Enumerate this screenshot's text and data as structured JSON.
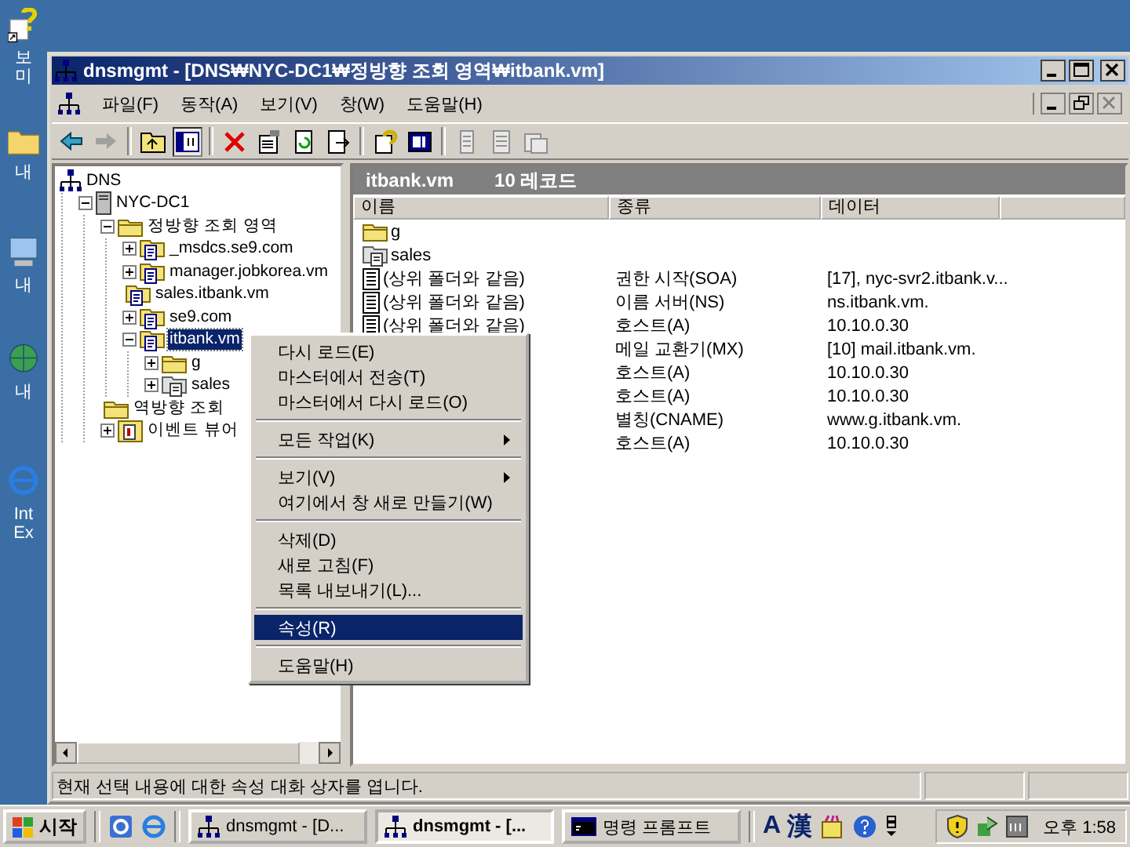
{
  "desktop_icons": [
    {
      "label": "보\n미",
      "kind": "help"
    },
    {
      "label": "내",
      "kind": "folder"
    },
    {
      "label": "내",
      "kind": "computer"
    },
    {
      "label": "내",
      "kind": "network"
    },
    {
      "label": "Int\nEx",
      "kind": "browser"
    }
  ],
  "window": {
    "title": "dnsmgmt - [DNS₩NYC-DC1₩정방향 조회 영역₩itbank.vm]"
  },
  "menu_bar": [
    "파일(F)",
    "동작(A)",
    "보기(V)",
    "창(W)",
    "도움말(H)"
  ],
  "tree": [
    {
      "label": "DNS",
      "kind": "dns",
      "selected": false,
      "children": [
        {
          "label": "NYC-DC1",
          "kind": "server",
          "expanded": true,
          "selected": false,
          "children": [
            {
              "label": "정방향 조회 영역",
              "kind": "folder",
              "expanded": true,
              "selected": false,
              "children": [
                {
                  "label": "_msdcs.se9.com",
                  "kind": "zone",
                  "expanded": false,
                  "selected": false
                },
                {
                  "label": "manager.jobkorea.vm",
                  "kind": "zone",
                  "expanded": false,
                  "selected": false
                },
                {
                  "label": "sales.itbank.vm",
                  "kind": "zone",
                  "selected": false
                },
                {
                  "label": "se9.com",
                  "kind": "zone",
                  "expanded": false,
                  "selected": false
                },
                {
                  "label": "itbank.vm",
                  "kind": "zone",
                  "expanded": true,
                  "selected": true,
                  "children": [
                    {
                      "label": "g",
                      "kind": "folder",
                      "expanded": false,
                      "selected": false
                    },
                    {
                      "label": "sales",
                      "kind": "delegation",
                      "expanded": false,
                      "selected": false
                    }
                  ]
                }
              ]
            },
            {
              "label": "역방향 조회",
              "kind": "folder",
              "selected": false
            },
            {
              "label": "이벤트 뷰어",
              "kind": "events",
              "expanded": false,
              "selected": false
            }
          ]
        }
      ]
    }
  ],
  "result_header": {
    "name": "itbank.vm",
    "count": "10 레코드"
  },
  "table": {
    "columns": [
      "이름",
      "종류",
      "데이터"
    ],
    "rows": [
      {
        "kind": "folder",
        "name": "g"
      },
      {
        "kind": "delegation",
        "name": "sales"
      },
      {
        "kind": "record",
        "name": "(상위 폴더와 같음)",
        "type": "권한 시작(SOA)",
        "data": "[17], nyc-svr2.itbank.v..."
      },
      {
        "kind": "record",
        "name": "(상위 폴더와 같음)",
        "type": "이름 서버(NS)",
        "data": "ns.itbank.vm."
      },
      {
        "kind": "record",
        "name": "(상위 폴더와 같음)",
        "type": "호스트(A)",
        "data": "10.10.0.30"
      },
      {
        "type": "메일 교환기(MX)",
        "data": "[10]  mail.itbank.vm."
      },
      {
        "type": "호스트(A)",
        "data": "10.10.0.30"
      },
      {
        "type": "호스트(A)",
        "data": "10.10.0.30"
      },
      {
        "type": "별칭(CNAME)",
        "data": "www.g.itbank.vm."
      },
      {
        "type": "호스트(A)",
        "data": "10.10.0.30"
      }
    ]
  },
  "context_menu": [
    {
      "kind": "item",
      "label": "다시 로드(E)",
      "selected": false
    },
    {
      "kind": "item",
      "label": "마스터에서 전송(T)",
      "selected": false
    },
    {
      "kind": "item",
      "label": "마스터에서 다시 로드(O)",
      "selected": false
    },
    {
      "kind": "separator"
    },
    {
      "kind": "submenu",
      "label": "모든 작업(K)",
      "selected": false
    },
    {
      "kind": "separator"
    },
    {
      "kind": "submenu",
      "label": "보기(V)",
      "selected": false
    },
    {
      "kind": "item",
      "label": "여기에서 창 새로 만들기(W)",
      "selected": false
    },
    {
      "kind": "separator"
    },
    {
      "kind": "item",
      "label": "삭제(D)",
      "selected": false
    },
    {
      "kind": "item",
      "label": "새로 고침(F)",
      "selected": false
    },
    {
      "kind": "item",
      "label": "목록 내보내기(L)...",
      "selected": false
    },
    {
      "kind": "separator"
    },
    {
      "kind": "item",
      "label": "속성(R)",
      "selected": true
    },
    {
      "kind": "separator"
    },
    {
      "kind": "item",
      "label": "도움말(H)",
      "selected": false
    }
  ],
  "status_bar": "현재 선택 내용에 대한 속성 대화 상자를 엽니다.",
  "taskbar": {
    "start": "시작",
    "tasks": [
      {
        "label": "dnsmgmt - [D...",
        "kind": "mmc",
        "selected": false
      },
      {
        "label": "dnsmgmt - [...",
        "kind": "mmc",
        "selected": true
      },
      {
        "label": "명령 프롬프트",
        "kind": "console",
        "selected": false
      }
    ],
    "ime": [
      "A",
      "漢"
    ],
    "clock": "오후 1:58"
  }
}
